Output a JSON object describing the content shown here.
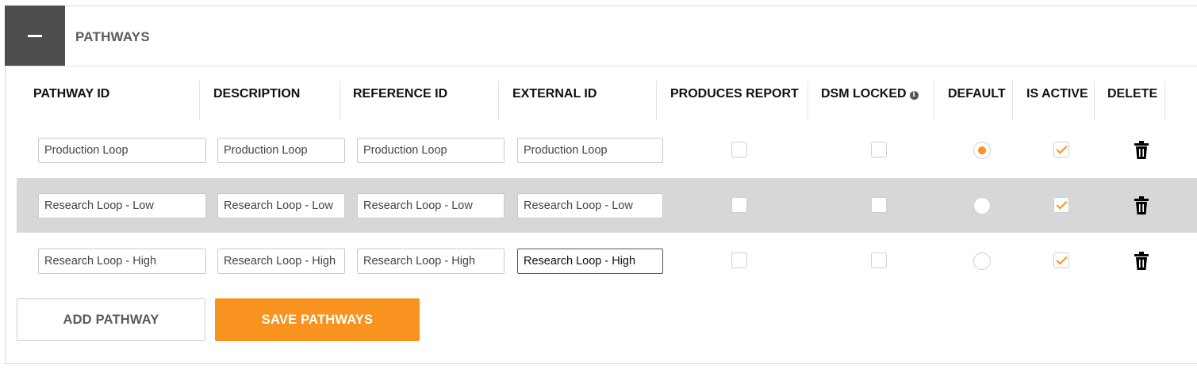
{
  "panel": {
    "title": "PATHWAYS",
    "collapse_icon": "minus-icon"
  },
  "columns": {
    "pathway_id": "PATHWAY ID",
    "description": "DESCRIPTION",
    "reference_id": "REFERENCE ID",
    "external_id": "EXTERNAL ID",
    "produces_report": "PRODUCES REPORT",
    "dsm_locked": "DSM LOCKED",
    "dsm_locked_icon": "info-icon",
    "default": "DEFAULT",
    "is_active": "IS ACTIVE",
    "delete": "DELETE"
  },
  "rows": [
    {
      "pathway_id": "Production Loop",
      "description": "Production Loop",
      "reference_id": "Production Loop",
      "external_id": "Production Loop",
      "produces_report": false,
      "dsm_locked": false,
      "default": true,
      "is_active": true
    },
    {
      "pathway_id": "Research Loop - Low",
      "description": "Research Loop - Low",
      "reference_id": "Research Loop - Low",
      "external_id": "Research Loop - Low",
      "produces_report": false,
      "dsm_locked": false,
      "default": false,
      "is_active": true
    },
    {
      "pathway_id": "Research Loop - High",
      "description": "Research Loop - High",
      "reference_id": "Research Loop - High",
      "external_id": "Research Loop - High",
      "produces_report": false,
      "dsm_locked": false,
      "default": false,
      "is_active": true
    }
  ],
  "actions": {
    "add_label": "ADD PATHWAY",
    "save_label": "SAVE PATHWAYS"
  },
  "colors": {
    "accent": "#f7931e",
    "header_dark": "#4d4d4d",
    "row_highlight": "#d6d7d6"
  }
}
